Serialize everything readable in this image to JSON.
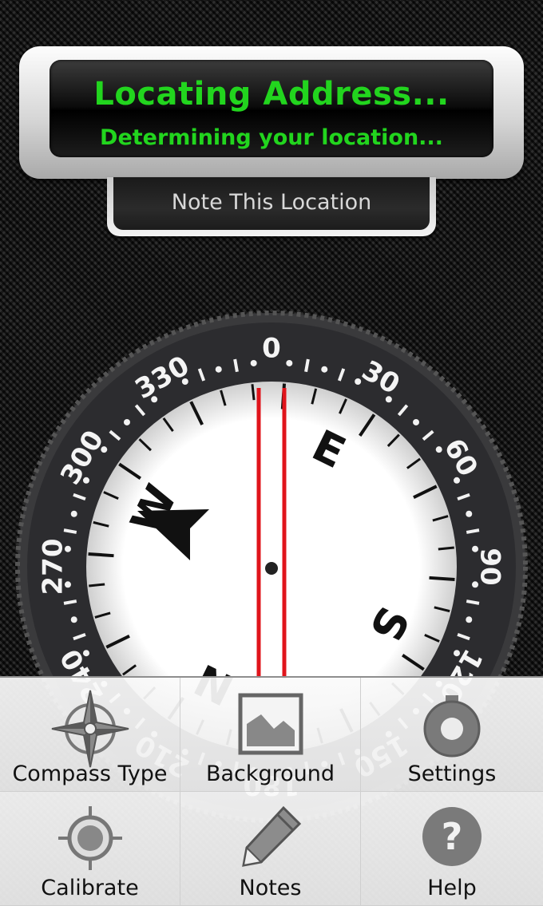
{
  "address_display": {
    "title": "Locating Address...",
    "subtitle": "Determining your location..."
  },
  "note_button": {
    "label": "Note This Location"
  },
  "compass": {
    "bezel_labels": [
      "0",
      "30",
      "60",
      "90",
      "120",
      "150",
      "180",
      "210",
      "240",
      "270",
      "300",
      "330"
    ],
    "dial_labels": [
      "N",
      "E",
      "S",
      "W"
    ],
    "colors": {
      "needle": "#e0141b",
      "bezel": "#2c2c2f",
      "face": "#ffffff"
    }
  },
  "menu": {
    "items": [
      {
        "label": "Compass Type",
        "icon": "compass-rose-icon"
      },
      {
        "label": "Background",
        "icon": "image-icon"
      },
      {
        "label": "Settings",
        "icon": "gear-icon"
      },
      {
        "label": "Calibrate",
        "icon": "crosshair-icon"
      },
      {
        "label": "Notes",
        "icon": "pencil-icon"
      },
      {
        "label": "Help",
        "icon": "help-icon"
      }
    ]
  }
}
